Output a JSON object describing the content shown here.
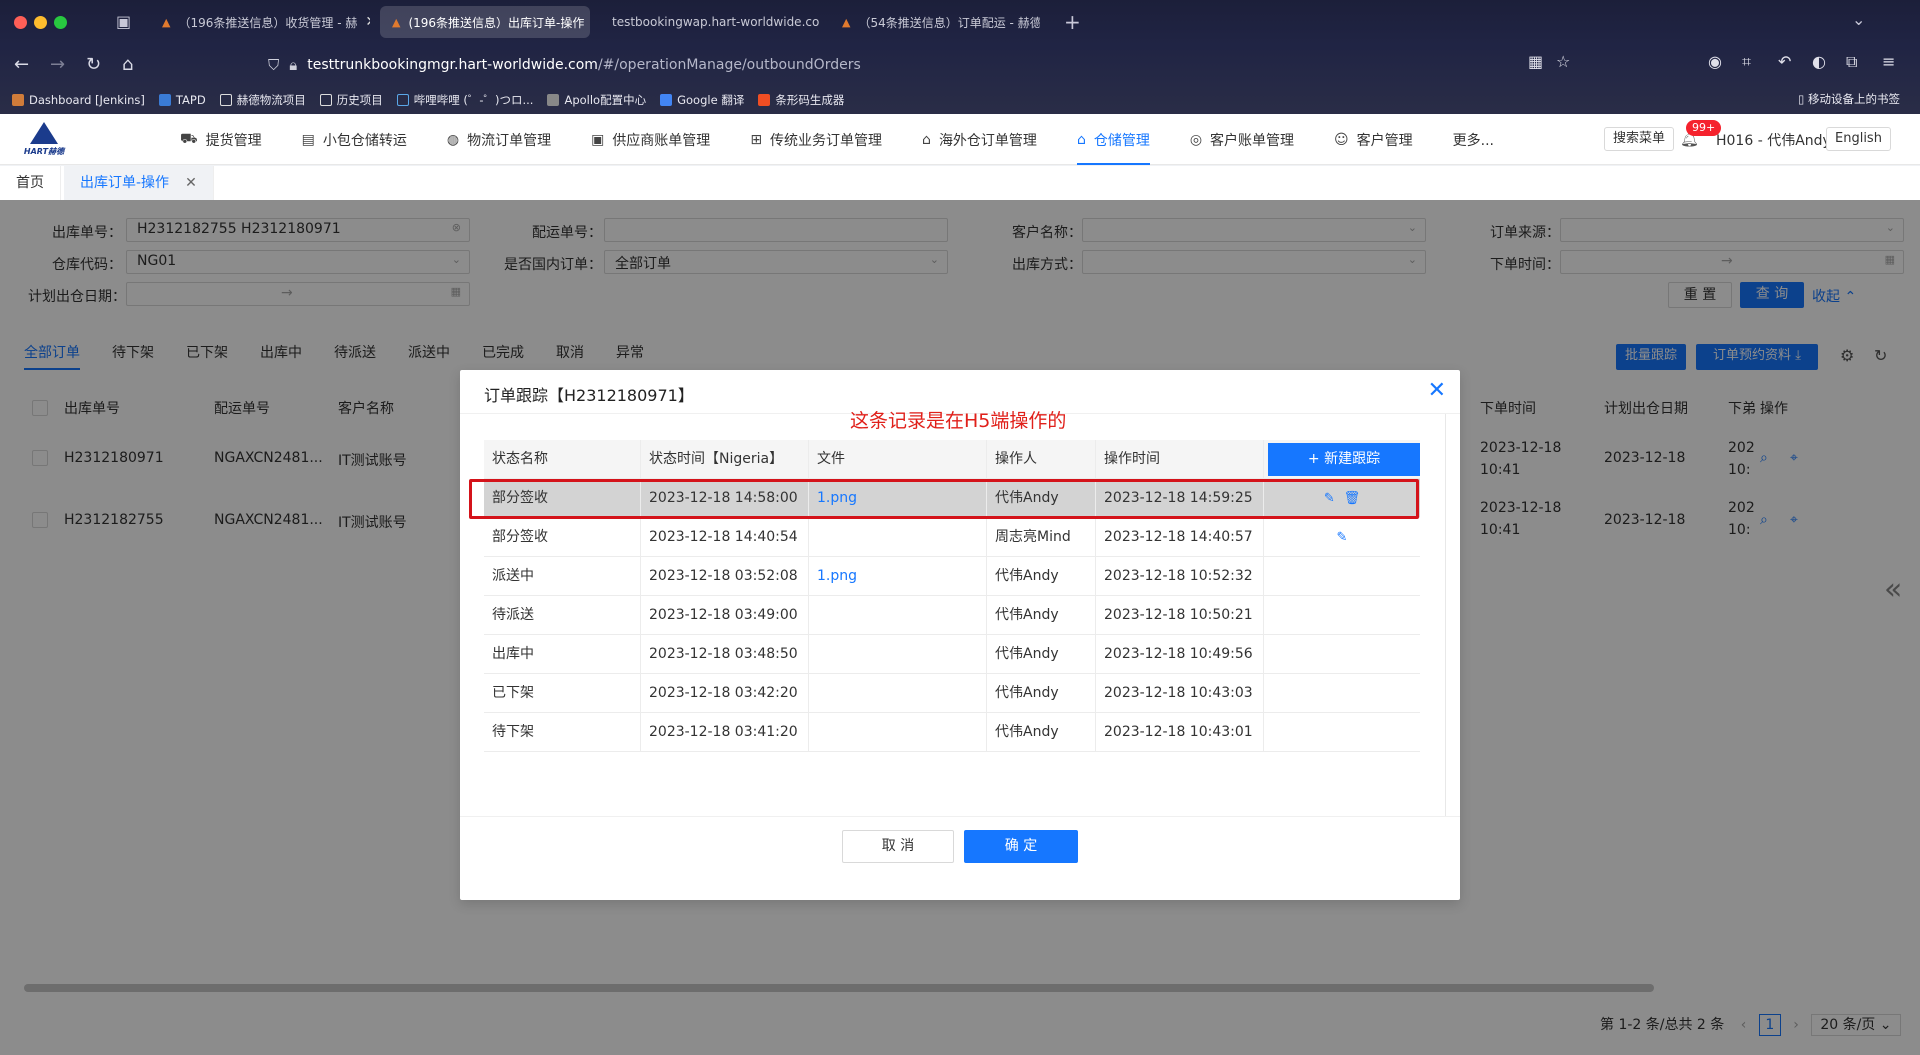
{
  "browser": {
    "tabs": [
      {
        "title": "（196条推送信息）收货管理 - 赫",
        "active": false
      },
      {
        "title": "(196条推送信息）出库订单-操作",
        "active": true
      },
      {
        "title": "testbookingwap.hart-worldwide.com",
        "active": false
      },
      {
        "title": "（54条推送信息）订单配运 - 赫德",
        "active": false
      }
    ],
    "url_host": "testtrunkbookingmgr.hart-worldwide.com",
    "url_path": "/#/operationManage/outboundOrders",
    "bookmarks": [
      "Dashboard [Jenkins]",
      "TAPD",
      "赫德物流项目",
      "历史项目",
      "哔哩哔哩 (゜-゜)つロ...",
      "Apollo配置中心",
      "Google 翻译",
      "条形码生成器"
    ],
    "mobile_bookmarks": "移动设备上的书签"
  },
  "app": {
    "logo_text": "HART赫德",
    "menu": [
      {
        "label": "提货管理",
        "icon": "truck-icon"
      },
      {
        "label": "小包仓储转运",
        "icon": "package-icon"
      },
      {
        "label": "物流订单管理",
        "icon": "globe-icon"
      },
      {
        "label": "供应商账单管理",
        "icon": "bill-icon"
      },
      {
        "label": "传统业务订单管理",
        "icon": "org-icon"
      },
      {
        "label": "海外仓订单管理",
        "icon": "warehouse-icon"
      },
      {
        "label": "仓储管理",
        "icon": "home-icon",
        "active": true
      },
      {
        "label": "客户账单管理",
        "icon": "coin-icon"
      },
      {
        "label": "客户管理",
        "icon": "user-icon"
      },
      {
        "label": "更多...",
        "icon": ""
      }
    ],
    "search_menu": "搜索菜单",
    "badge": "99+",
    "user": "H016 - 代伟Andy",
    "lang": "English"
  },
  "page_tabs": [
    {
      "label": "首页",
      "active": false
    },
    {
      "label": "出库订单-操作",
      "active": true
    }
  ],
  "filters": {
    "outbound_no_label": "出库单号：",
    "outbound_no_value": "H2312182755 H2312180971",
    "ship_no_label": "配运单号：",
    "customer_label": "客户名称：",
    "source_label": "订单来源：",
    "wh_code_label": "仓库代码：",
    "wh_code_value": "NG01",
    "domestic_label": "是否国内订单：",
    "domestic_value": "全部订单",
    "out_method_label": "出库方式：",
    "order_time_label": "下单时间：",
    "plan_date_label": "计划出仓日期：",
    "reset": "重 置",
    "query": "查 询",
    "collapse": "收起"
  },
  "status_tabs": [
    "全部订单",
    "待下架",
    "已下架",
    "出库中",
    "待派送",
    "派送中",
    "已完成",
    "取消",
    "异常"
  ],
  "actions": {
    "batch_track": "批量跟踪",
    "booking": "订单预约资料"
  },
  "table": {
    "headers": [
      "出库单号",
      "配运单号",
      "客户名称",
      "下单时间",
      "计划出仓日期",
      "下弟",
      "操作"
    ],
    "rows": [
      {
        "no": "H2312180971",
        "ship": "NGAXCN2481...",
        "customer": "IT测试账号",
        "time1": "2023-12-18",
        "time2": "10:41",
        "plan": "2023-12-18",
        "cut": "202",
        "cut2": "10:"
      },
      {
        "no": "H2312182755",
        "ship": "NGAXCN2481...",
        "customer": "IT测试账号",
        "time1": "2023-12-18",
        "time2": "10:41",
        "plan": "2023-12-18",
        "cut": "202",
        "cut2": "10:"
      }
    ]
  },
  "pagination": {
    "summary": "第 1-2 条/总共 2 条",
    "page": "1",
    "size": "20 条/页"
  },
  "modal": {
    "title": "订单跟踪【H2312180971】",
    "annotation": "这条记录是在H5端操作的",
    "headers": [
      "状态名称",
      "状态时间【Nigeria】",
      "文件",
      "操作人",
      "操作时间"
    ],
    "new_button": "+ 新建跟踪",
    "rows": [
      {
        "status": "部分签收",
        "time": "2023-12-18 14:58:00",
        "file": "1.png",
        "operator": "代伟Andy",
        "op_time": "2023-12-18 14:59:25",
        "edit": true,
        "delete": true
      },
      {
        "status": "部分签收",
        "time": "2023-12-18 14:40:54",
        "file": "",
        "operator": "周志亮Mind",
        "op_time": "2023-12-18 14:40:57",
        "edit": true,
        "delete": false
      },
      {
        "status": "派送中",
        "time": "2023-12-18 03:52:08",
        "file": "1.png",
        "operator": "代伟Andy",
        "op_time": "2023-12-18 10:52:32",
        "edit": false,
        "delete": false
      },
      {
        "status": "待派送",
        "time": "2023-12-18 03:49:00",
        "file": "",
        "operator": "代伟Andy",
        "op_time": "2023-12-18 10:50:21",
        "edit": false,
        "delete": false
      },
      {
        "status": "出库中",
        "time": "2023-12-18 03:48:50",
        "file": "",
        "operator": "代伟Andy",
        "op_time": "2023-12-18 10:49:56",
        "edit": false,
        "delete": false
      },
      {
        "status": "已下架",
        "time": "2023-12-18 03:42:20",
        "file": "",
        "operator": "代伟Andy",
        "op_time": "2023-12-18 10:43:03",
        "edit": false,
        "delete": false
      },
      {
        "status": "待下架",
        "time": "2023-12-18 03:41:20",
        "file": "",
        "operator": "代伟Andy",
        "op_time": "2023-12-18 10:43:01",
        "edit": false,
        "delete": false
      }
    ],
    "cancel": "取 消",
    "ok": "确 定"
  },
  "colors": {
    "primary": "#1677ff",
    "annotation_red": "#e0201a",
    "highlight_row": "#d3d3d3"
  }
}
